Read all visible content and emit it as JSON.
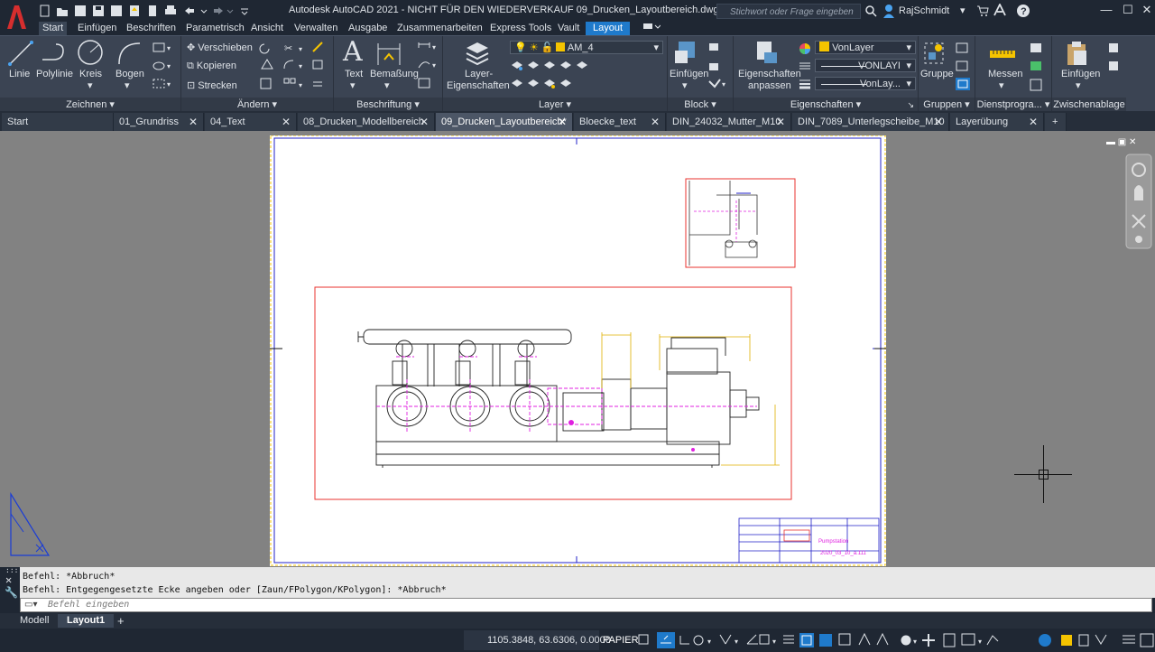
{
  "title": "Autodesk AutoCAD 2021 - NICHT FÜR DEN WIEDERVERKAUF   09_Drucken_Layoutbereich.dwg",
  "search_placeholder": "Stichwort oder Frage eingeben",
  "user": "RajSchmidt",
  "ribbon_tabs": [
    "Start",
    "Einfügen",
    "Beschriften",
    "Parametrisch",
    "Ansicht",
    "Verwalten",
    "Ausgabe",
    "Zusammenarbeiten",
    "Express Tools",
    "Vault",
    "Layout"
  ],
  "panels": {
    "zeichnen": {
      "title": "Zeichnen",
      "linie": "Linie",
      "polylinie": "Polylinie",
      "kreis": "Kreis",
      "bogen": "Bogen"
    },
    "aendern": {
      "title": "Ändern",
      "verschieben": "Verschieben",
      "kopieren": "Kopieren",
      "strecken": "Strecken"
    },
    "beschriftung": {
      "title": "Beschriftung",
      "text": "Text",
      "bemassung": "Bemaßung"
    },
    "layer": {
      "title": "Layer",
      "eigenschaften_l1": "Layer-",
      "eigenschaften_l2": "Eigenschaften",
      "current": "AM_4"
    },
    "block": {
      "title": "Block",
      "einfuegen": "Einfügen"
    },
    "eigenschaften": {
      "title": "Eigenschaften",
      "anpassen_l1": "Eigenschaften",
      "anpassen_l2": "anpassen",
      "color": "VonLayer",
      "linetype": "VONLAYI",
      "lineweight": "VonLay..."
    },
    "gruppen": {
      "title": "Gruppen",
      "gruppe": "Gruppe"
    },
    "dienst": {
      "title": "Dienstprogra...",
      "messen": "Messen"
    },
    "zwischenablage": {
      "title": "Zwischenablage",
      "einfuegen": "Einfügen"
    }
  },
  "doc_tabs": [
    "Start",
    "01_Grundriss",
    "04_Text",
    "08_Drucken_Modellbereich",
    "09_Drucken_Layoutbereich*",
    "Bloecke_text",
    "DIN_24032_Mutter_M10",
    "DIN_7089_Unterlegscheibe_M10",
    "Layerübung"
  ],
  "titleblock": {
    "name": "Pumpstation",
    "number": "2020_03_10_a.111"
  },
  "command_history": [
    "Befehl: *Abbruch*",
    "Befehl: Entgegengesetzte Ecke angeben oder [Zaun/FPolygon/KPolygon]: *Abbruch*"
  ],
  "command_placeholder": "Befehl eingeben",
  "layout_tabs": [
    "Modell",
    "Layout1"
  ],
  "coordinates": "1105.3848, 63.6306, 0.0000",
  "space": "PAPIER",
  "colors": {
    "accent": "#1f7acb",
    "layer_color": "#f5c400",
    "viewport": "#e8332f",
    "magenta": "#e020e0",
    "dim": "#e0b000"
  }
}
